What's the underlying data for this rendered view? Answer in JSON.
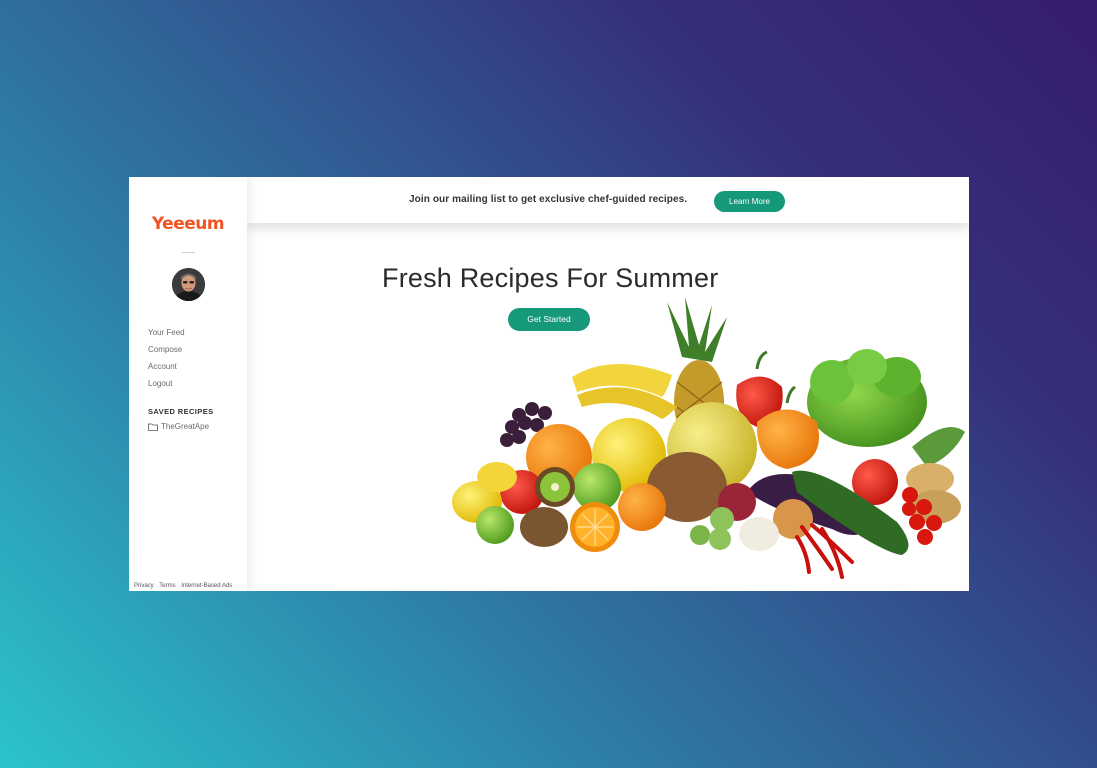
{
  "brand": {
    "logo_text": "Yeeeum",
    "accent_color": "#ef5423",
    "button_color": "#16987a"
  },
  "sidebar": {
    "avatar": "user-avatar",
    "nav": [
      {
        "label": "Your Feed"
      },
      {
        "label": "Compose"
      },
      {
        "label": "Account"
      },
      {
        "label": "Logout"
      }
    ],
    "saved_heading": "SAVED RECIPES",
    "saved_items": [
      {
        "label": "TheGreatApe",
        "icon": "folder-icon"
      }
    ],
    "footer_links": [
      "Privacy",
      "Terms",
      "Internet-Based Ads"
    ]
  },
  "banner": {
    "text": "Join our mailing list to get exclusive chef-guided recipes.",
    "button_label": "Learn More"
  },
  "hero": {
    "title": "Fresh Recipes For Summer",
    "button_label": "Get Started",
    "image": "fruits-and-vegetables-image"
  }
}
